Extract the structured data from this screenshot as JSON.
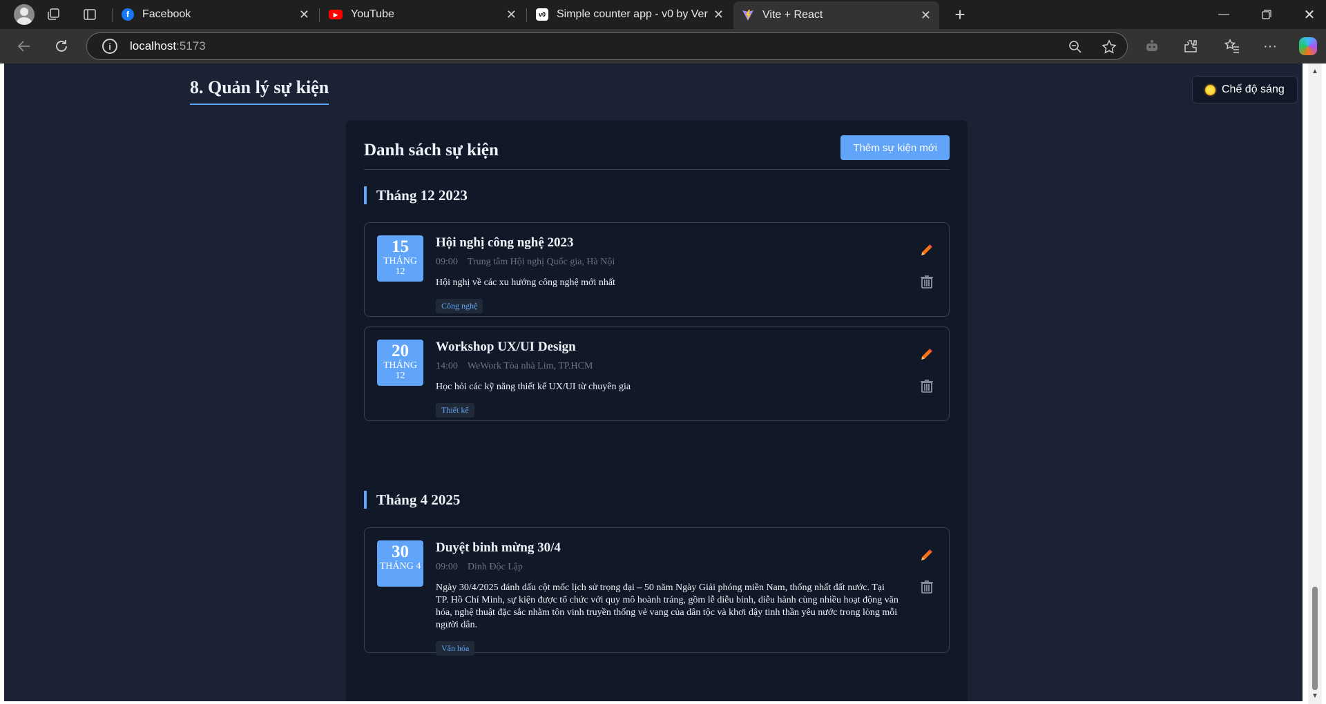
{
  "browser": {
    "tabs": [
      {
        "title": "Facebook"
      },
      {
        "title": "YouTube"
      },
      {
        "title": "Simple counter app - v0 by Vercel"
      },
      {
        "title": "Vite + React"
      }
    ],
    "url_host": "localhost",
    "url_port": ":5173"
  },
  "page": {
    "section_title": "8. Quản lý sự kiện",
    "theme_toggle": "Chế độ sáng",
    "list_title": "Danh sách sự kiện",
    "add_button": "Thêm sự kiện mới",
    "groups": [
      {
        "month": "Tháng 12 2023",
        "events": [
          {
            "day": "15",
            "month_label": "THÁNG",
            "month_num": "12",
            "title": "Hội nghị công nghệ 2023",
            "time": "09:00",
            "location": "Trung tâm Hội nghị Quốc gia, Hà Nội",
            "description": "Hội nghị về các xu hướng công nghệ mới nhất",
            "tag": "Công nghệ"
          },
          {
            "day": "20",
            "month_label": "THÁNG",
            "month_num": "12",
            "title": "Workshop UX/UI Design",
            "time": "14:00",
            "location": "WeWork Tòa nhà Lim, TP.HCM",
            "description": "Học hỏi các kỹ năng thiết kế UX/UI từ chuyên gia",
            "tag": "Thiết kế"
          }
        ]
      },
      {
        "month": "Tháng 4 2025",
        "events": [
          {
            "day": "30",
            "month_label": "THÁNG 4",
            "title": "Duyệt binh mừng 30/4",
            "time": "09:00",
            "location": "Dinh Độc Lập",
            "description": "Ngày 30/4/2025 đánh dấu cột mốc lịch sử trọng đại – 50 năm Ngày Giải phóng miền Nam, thống nhất đất nước. Tại TP. Hồ Chí Minh, sự kiện được tổ chức với quy mô hoành tráng, gồm lễ diễu binh, diễu hành cùng nhiều hoạt động văn hóa, nghệ thuật đặc sắc nhằm tôn vinh truyền thống vẻ vang của dân tộc và khơi dậy tinh thần yêu nước trong lòng mỗi người dân.",
            "tag": "Văn hóa"
          }
        ]
      }
    ]
  },
  "icons": {
    "edit": "pencil-icon",
    "delete": "trash-icon"
  },
  "colors": {
    "accent": "#60a5fa",
    "page_bg": "#1a2233",
    "card_bg": "#111827",
    "edit_icon": "#f97316"
  }
}
